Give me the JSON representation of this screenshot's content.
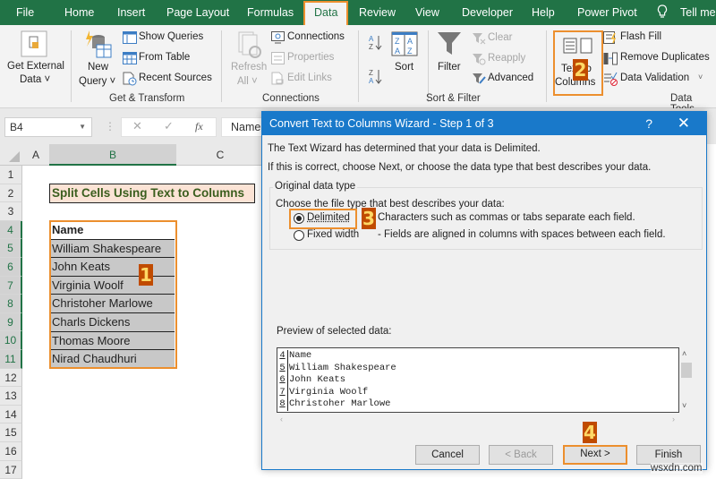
{
  "ribbon_tabs": [
    "File",
    "Home",
    "Insert",
    "Page Layout",
    "Formulas",
    "Data",
    "Review",
    "View",
    "Developer",
    "Help",
    "Power Pivot"
  ],
  "active_tab": "Data",
  "tell_me": "Tell me",
  "ribbon": {
    "get_external_data": [
      "Get External",
      "Data ˅"
    ],
    "new_query": [
      "New",
      "Query ˅"
    ],
    "show_queries": "Show Queries",
    "from_table": "From Table",
    "recent_sources": "Recent Sources",
    "get_transform_label": "Get & Transform",
    "refresh_all": [
      "Refresh",
      "All ˅"
    ],
    "connections": "Connections",
    "properties": "Properties",
    "edit_links": "Edit Links",
    "connections_label": "Connections",
    "sort": "Sort",
    "filter": "Filter",
    "clear": "Clear",
    "reapply": "Reapply",
    "advanced": "Advanced",
    "sort_filter_label": "Sort & Filter",
    "text_to_columns": [
      "Text to",
      "Columns"
    ],
    "flash_fill": "Flash Fill",
    "remove_duplicates": "Remove Duplicates",
    "data_validation": "Data Validation",
    "data_tools_label": "Data Tools"
  },
  "formula_bar": {
    "name_box": "B4",
    "cancel_symbol": "✕",
    "enter_symbol": "✓",
    "fx_symbol": "fx",
    "content": "Name"
  },
  "sheet": {
    "columns": [
      "A",
      "B",
      "C"
    ],
    "rows": [
      "1",
      "2",
      "3",
      "4",
      "5",
      "6",
      "7",
      "8",
      "9",
      "10",
      "11",
      "12",
      "13",
      "14",
      "15",
      "16",
      "17"
    ],
    "title": "Split Cells Using Text to Columns",
    "header": "Name",
    "names": [
      "William Shakespeare",
      "John Keats",
      "Virginia Woolf",
      "Christoher Marlowe",
      "Charls Dickens",
      "Thomas Moore",
      "Nirad Chaudhuri"
    ]
  },
  "badges": [
    "1",
    "2",
    "3",
    "4"
  ],
  "dialog": {
    "title": "Convert Text to Columns Wizard - Step 1 of 3",
    "help": "?",
    "close": "✕",
    "line1": "The Text Wizard has determined that your data is Delimited.",
    "line2": "If this is correct, choose Next, or choose the data type that best describes your data.",
    "group_label": "Original data type",
    "choose_label": "Choose the file type that best describes your data:",
    "options": [
      {
        "label": "Delimited",
        "desc": "Characters such as commas or tabs separate each field.",
        "selected": true
      },
      {
        "label": "Fixed width",
        "desc": "- Fields are aligned in columns with spaces between each field.",
        "selected": false
      }
    ],
    "preview_label": "Preview of selected data:",
    "preview_lines": [
      {
        "num": "4",
        "text": "Name"
      },
      {
        "num": "5",
        "text": "William Shakespeare"
      },
      {
        "num": "6",
        "text": "John Keats"
      },
      {
        "num": "7",
        "text": "Virginia Woolf"
      },
      {
        "num": "8",
        "text": "Christoher Marlowe"
      }
    ],
    "buttons": {
      "cancel": "Cancel",
      "back": "< Back",
      "next": "Next >",
      "finish": "Finish"
    }
  },
  "watermark": "wsxdn.com",
  "colors": {
    "excel_green": "#217346",
    "highlight_orange": "#ec8f2e",
    "dialog_blue": "#1979ca",
    "badge_bg": "#c04b00",
    "badge_text": "#ffd966"
  }
}
